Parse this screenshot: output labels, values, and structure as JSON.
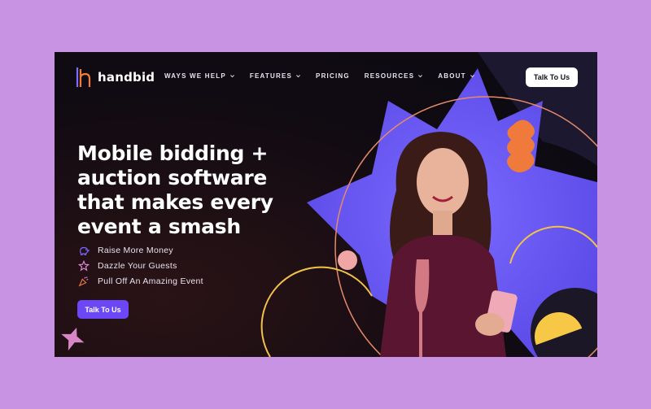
{
  "brand": {
    "name": "handbid"
  },
  "nav": {
    "items": [
      {
        "label": "WAYS WE HELP",
        "dropdown": true
      },
      {
        "label": "FEATURES",
        "dropdown": true
      },
      {
        "label": "PRICING",
        "dropdown": false
      },
      {
        "label": "RESOURCES",
        "dropdown": true
      },
      {
        "label": "ABOUT",
        "dropdown": true
      }
    ],
    "cta_label": "Talk To Us"
  },
  "hero": {
    "headline_lines": [
      "Mobile bidding +",
      "auction software",
      "that makes every",
      "event a smash"
    ],
    "features": [
      {
        "icon": "piggy-bank-icon",
        "label": "Raise More Money"
      },
      {
        "icon": "sparkle-star-icon",
        "label": "Dazzle Your Guests"
      },
      {
        "icon": "party-popper-icon",
        "label": "Pull Off An Amazing Event"
      }
    ],
    "cta_label": "Talk To Us"
  },
  "colors": {
    "page_background": "#c893e3",
    "hero_background": "#0b0a10",
    "accent_purple": "#6c47f5",
    "burst_purple": "#6a5cf0",
    "orange": "#ef7a3b",
    "yellow": "#f7c846",
    "pink": "#e58aa3"
  }
}
